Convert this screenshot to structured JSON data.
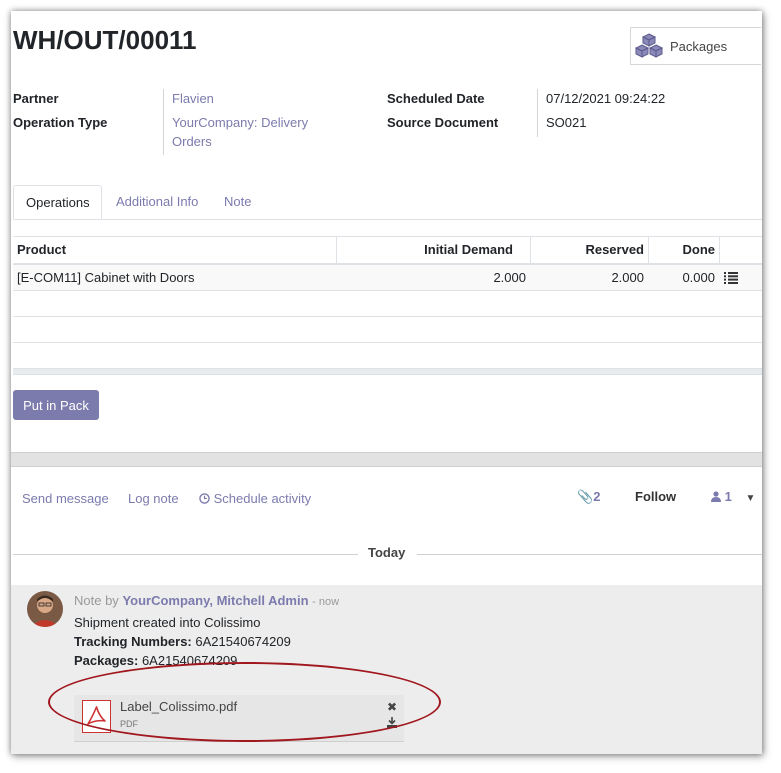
{
  "record": {
    "title": "WH/OUT/00011"
  },
  "smart_button": {
    "label": "Packages",
    "icon": "cubes-icon"
  },
  "fields": {
    "partner_label": "Partner",
    "partner_value": "Flavien",
    "operation_type_label": "Operation Type",
    "operation_type_value": "YourCompany: Delivery Orders",
    "scheduled_date_label": "Scheduled Date",
    "scheduled_date_value": "07/12/2021 09:24:22",
    "source_document_label": "Source Document",
    "source_document_value": "SO021"
  },
  "tabs": [
    {
      "label": "Operations",
      "active": true
    },
    {
      "label": "Additional Info",
      "active": false
    },
    {
      "label": "Note",
      "active": false
    }
  ],
  "table": {
    "columns": [
      "Product",
      "Initial Demand",
      "Reserved",
      "Done"
    ],
    "rows": [
      {
        "product": "[E-COM11] Cabinet with Doors",
        "initial_demand": "2.000",
        "reserved": "2.000",
        "done": "0.000",
        "icon": "list-icon"
      }
    ]
  },
  "actions": {
    "put_in_pack": "Put in Pack"
  },
  "chatter": {
    "send_message": "Send message",
    "log_note": "Log note",
    "schedule_activity": "Schedule activity",
    "attachments_count": "2",
    "follow": "Follow",
    "followers_count": "1",
    "date_separator": "Today",
    "message": {
      "prefix": "Note by",
      "author": "YourCompany, Mitchell Admin",
      "time": "- now",
      "body": "Shipment created into Colissimo",
      "tracking_label": "Tracking Numbers:",
      "tracking_value": "6A21540674209",
      "packages_label": "Packages:",
      "packages_value": "6A21540674209",
      "attachment_name": "Label_Colissimo.pdf",
      "attachment_type": "PDF"
    }
  },
  "colors": {
    "accent": "#7c7bad",
    "highlight_ellipse": "#a1171e"
  }
}
